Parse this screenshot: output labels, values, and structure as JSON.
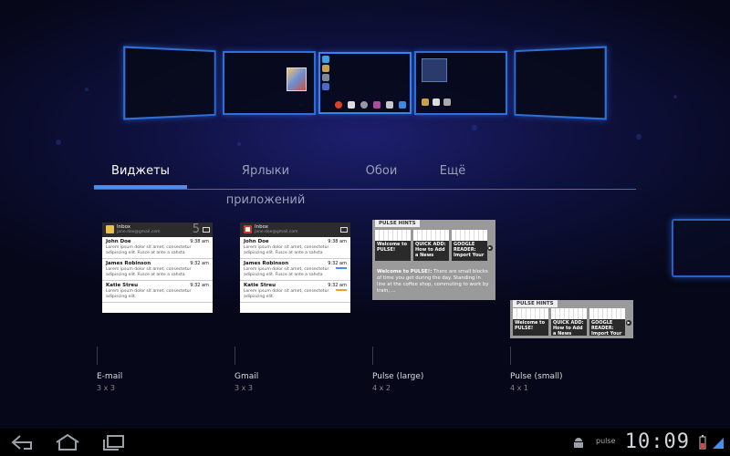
{
  "tabs": [
    {
      "label": "Виджеты"
    },
    {
      "label": "Ярлыки приложений"
    },
    {
      "label": "Обои"
    },
    {
      "label": "Ещё"
    }
  ],
  "widgets": [
    {
      "name": "E-mail",
      "size": "3 x 3",
      "preview": {
        "inbox": "Inbox",
        "address": "jane.doe@gmail.com",
        "count": "5",
        "messages": [
          {
            "from": "John Doe",
            "time": "9:38 am",
            "body": "Lorem ipsum dolor sit amet, consectetur adipiscing elit. Fusce at ante a sahsta"
          },
          {
            "from": "James Robinson",
            "time": "9:32 am",
            "body": "Lorem ipsum dolor sit amet, consectetur adipiscing elit. Fusce at ante a sahsta"
          },
          {
            "from": "Katie Streu",
            "time": "9:32 am",
            "body": "Lorem ipsum dolor sit amet, consectetur adipiscing elit."
          }
        ]
      }
    },
    {
      "name": "Gmail",
      "size": "3 x 3",
      "preview": {
        "inbox": "Inbox",
        "address": "jane.doe@gmail.com",
        "messages": [
          {
            "from": "John Doe",
            "time": "9:38 am",
            "body": "Lorem ipsum dolor sit amet, consectetur adipiscing elit. Fusce at ante a sahsta"
          },
          {
            "from": "James Robinson",
            "time": "9:32 am",
            "body": "Lorem ipsum dolor sit amet, consectetur adipiscing elit. Fusce at ante a sahsta"
          },
          {
            "from": "Katie Streu",
            "time": "9:32 am",
            "body": "Lorem ipsum dolor sit amet, consectetur adipiscing elit."
          }
        ]
      }
    },
    {
      "name": "Pulse (large)",
      "size": "4 x 2",
      "preview": {
        "header": "PULSE HINTS",
        "tiles": [
          "Welcome to PULSE!",
          "QUICK ADD: How to Add a News",
          "GOOGLE READER: Import Your"
        ],
        "desc_title": "Welcome to PULSE!:",
        "desc_text": "There are small blocks of time you get during the day. Standing in line at the coffee shop, commuting to work by train, ..."
      }
    },
    {
      "name": "Pulse (small)",
      "size": "4 x 1",
      "preview": {
        "header": "PULSE HINTS",
        "tiles": [
          "Welcome to PULSE!",
          "QUICK ADD: How to Add a News",
          "GOOGLE READER: Import Your"
        ]
      }
    }
  ],
  "statusbar": {
    "time": "10:09",
    "pulse_label": "pulse"
  },
  "colors": {
    "accent": "#4a8cf0",
    "screen_border": "#2f6fd8"
  }
}
